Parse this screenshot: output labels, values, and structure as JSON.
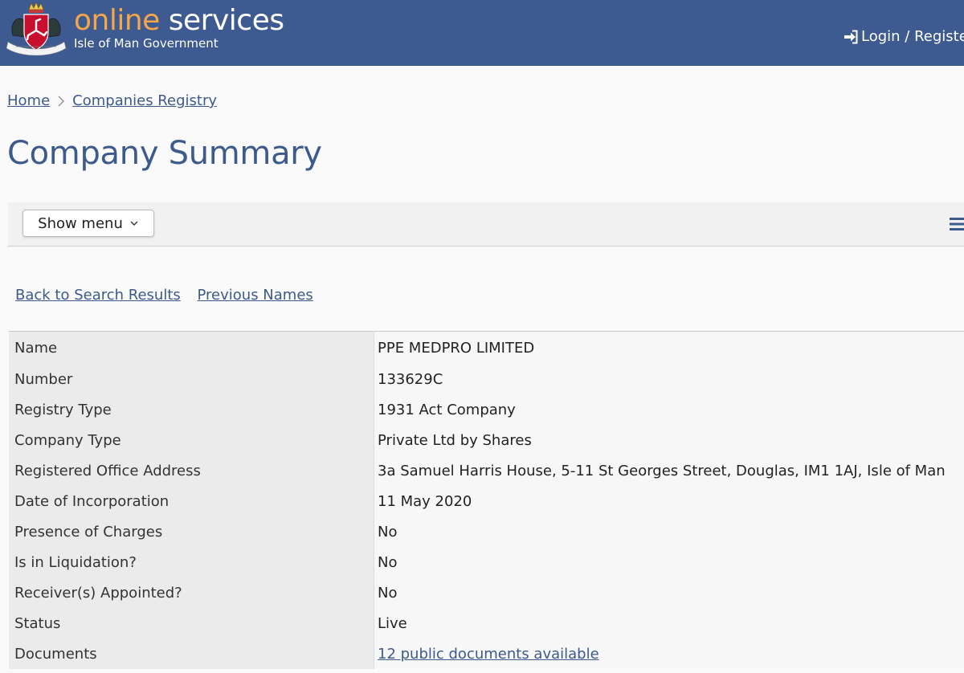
{
  "header": {
    "brand_online": "online",
    "brand_services": "services",
    "brand_subtitle": "Isle of Man Government",
    "login_label": "Login / Registe",
    "icons": {
      "crest": "isle-of-man-crest-icon",
      "login": "sign-in-icon"
    },
    "colors": {
      "bar": "#3d5b90",
      "online": "#f5a54a"
    }
  },
  "breadcrumb": {
    "items": [
      {
        "label": "Home"
      },
      {
        "label": "Companies Registry"
      }
    ]
  },
  "page": {
    "title": "Company Summary"
  },
  "menu": {
    "show_menu_label": "Show menu"
  },
  "links": {
    "back": "Back to Search Results",
    "previous_names": "Previous Names"
  },
  "details": {
    "rows": [
      {
        "label": "Name",
        "value": "PPE MEDPRO LIMITED"
      },
      {
        "label": "Number",
        "value": "133629C"
      },
      {
        "label": "Registry Type",
        "value": "1931 Act Company"
      },
      {
        "label": "Company Type",
        "value": "Private Ltd by Shares"
      },
      {
        "label": "Registered Office Address",
        "value": "3a Samuel Harris House, 5-11 St Georges Street, Douglas, IM1 1AJ, Isle of Man"
      },
      {
        "label": "Date of Incorporation",
        "value": "11 May 2020"
      },
      {
        "label": "Presence of Charges",
        "value": "No"
      },
      {
        "label": "Is in Liquidation?",
        "value": "No"
      },
      {
        "label": "Receiver(s) Appointed?",
        "value": "No"
      },
      {
        "label": "Status",
        "value": "Live"
      },
      {
        "label": "Documents",
        "value": "12 public documents available"
      }
    ]
  }
}
